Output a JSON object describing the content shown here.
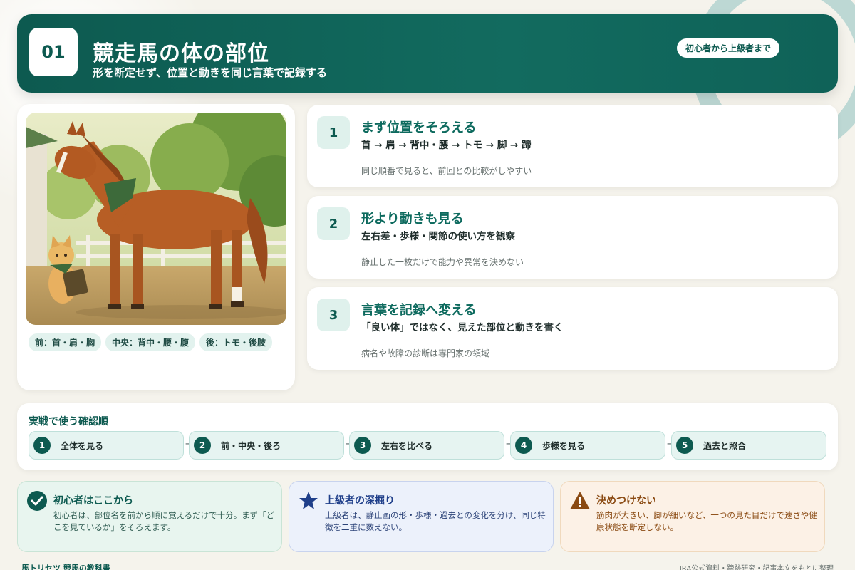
{
  "header": {
    "number": "01",
    "title": "競走馬の体の部位",
    "subtitle": "形を断定せず、位置と動きを同じ言葉で記録する",
    "level_badge": "初心者から上級者まで"
  },
  "image_card": {
    "tags": [
      "前：首・肩・胸",
      "中央：背中・腰・腹",
      "後：トモ・後肢"
    ]
  },
  "steps": [
    {
      "number": "1",
      "title": "まず位置をそろえる",
      "detail": "首 → 肩 → 背中・腰 → トモ → 脚 → 蹄",
      "note": "同じ順番で見ると、前回との比較がしやすい"
    },
    {
      "number": "2",
      "title": "形より動きも見る",
      "detail": "左右差・歩様・関節の使い方を観察",
      "note": "静止した一枚だけで能力や異常を決めない"
    },
    {
      "number": "3",
      "title": "言葉を記録へ変える",
      "detail": "「良い体」ではなく、見えた部位と動きを書く",
      "note": "病名や故障の診断は専門家の領域"
    }
  ],
  "flow": {
    "title": "実戦で使う確認順",
    "arrow": "→",
    "items": [
      {
        "number": "1",
        "label": "全体を見る"
      },
      {
        "number": "2",
        "label": "前・中央・後ろ"
      },
      {
        "number": "3",
        "label": "左右を比べる"
      },
      {
        "number": "4",
        "label": "歩様を見る"
      },
      {
        "number": "5",
        "label": "過去と照合"
      }
    ]
  },
  "tips": [
    {
      "icon": "check-icon",
      "title": "初心者はここから",
      "text": "初心者は、部位名を前から順に覚えるだけで十分。まず「どこを見ているか」をそろえます。",
      "bg": "#e8f5ef",
      "border": "#c9e4d6",
      "title_color": "#0d5a50",
      "text_color": "#2d5a50"
    },
    {
      "icon": "star-icon",
      "title": "上級者の深掘り",
      "text": "上級者は、静止画の形・歩様・過去との変化を分け、同じ特徴を二重に数えない。",
      "bg": "#ecf1fb",
      "border": "#c8d3ee",
      "title_color": "#1f3f8a",
      "text_color": "#2c4378"
    },
    {
      "icon": "warning-icon",
      "title": "決めつけない",
      "text": "筋肉が大きい、脚が細いなど、一つの見た目だけで速さや健康状態を断定しない。",
      "bg": "#fcf1e6",
      "border": "#f0d9bd",
      "title_color": "#8a4a12",
      "text_color": "#8a4a12"
    }
  ],
  "footer": {
    "left": "馬トリセツ 競馬の教科書",
    "right": "JRA公式資料・蹄跡研究・記事本文をもとに整理"
  },
  "colors": {
    "primary": "#0d5a50",
    "background": "#f5f3ec"
  }
}
